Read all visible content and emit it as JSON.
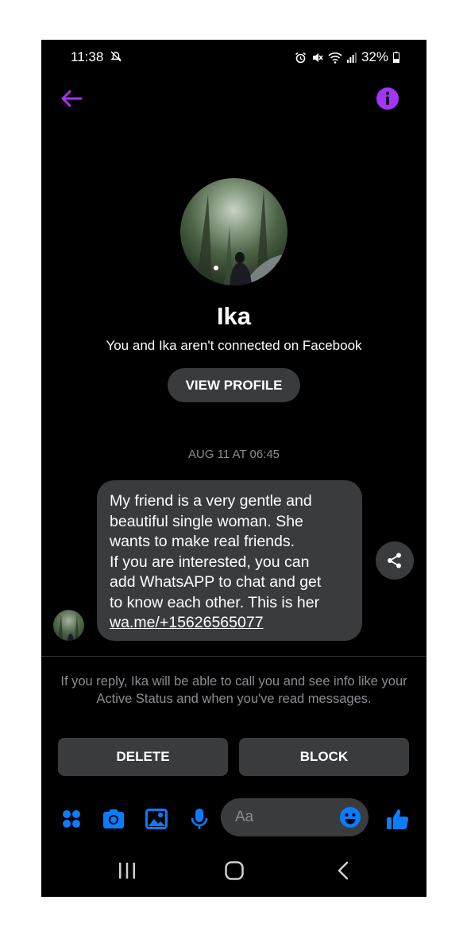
{
  "status_bar": {
    "time": "11:38",
    "battery": "32%",
    "icons": [
      "mute-notification-icon",
      "alarm-icon",
      "mute-icon",
      "wifi-icon",
      "signal-icon",
      "battery-icon"
    ]
  },
  "header": {
    "back_icon": "arrow-left-icon",
    "info_icon": "info-icon",
    "accent_color": "#a334fa"
  },
  "profile": {
    "name": "Ika",
    "connection_text": "You and Ika aren't connected on Facebook",
    "view_profile_label": "VIEW PROFILE"
  },
  "conversation": {
    "timestamp": "AUG 11 AT 06:45",
    "message": {
      "lines": [
        "My friend is a very gentle and",
        "beautiful single woman. She",
        "wants to make real friends.",
        "If you are interested, you can",
        "add WhatsAPP to chat and get",
        "to know each other. This is her"
      ],
      "link": "wa.me/+15626565077"
    }
  },
  "request_notice": {
    "text": "If you reply, Ika will be able to call you and see info like your Active Status and when you've read messages.",
    "delete_label": "DELETE",
    "block_label": "BLOCK"
  },
  "composer": {
    "placeholder": "Aa",
    "icons": [
      "apps-icon",
      "camera-icon",
      "gallery-icon",
      "microphone-icon",
      "emoji-icon",
      "thumbs-up-icon"
    ],
    "accent_color": "#0a7cff"
  },
  "nav_bar": {
    "icons": [
      "recent-apps-icon",
      "home-icon",
      "back-icon"
    ]
  }
}
